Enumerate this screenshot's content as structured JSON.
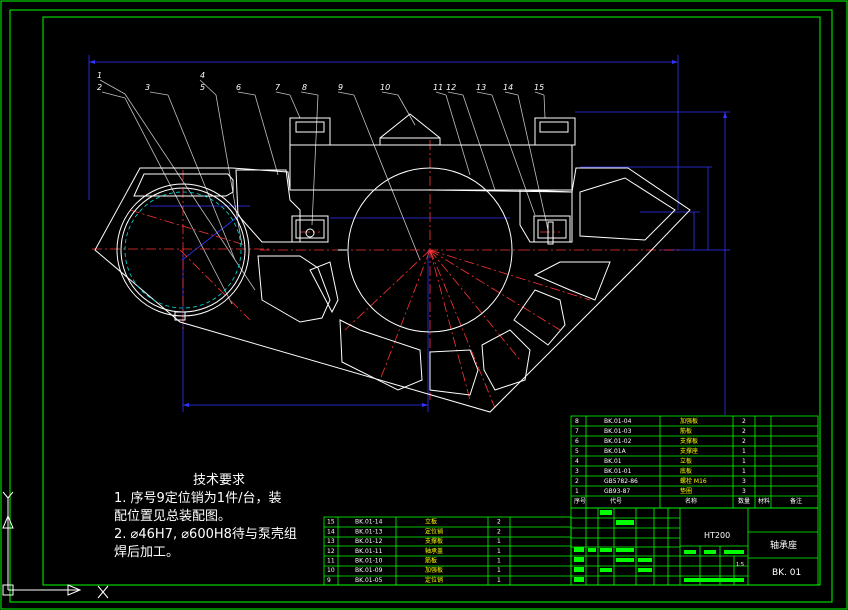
{
  "colors": {
    "background": "#000000",
    "frame": "#00ff00",
    "outline": "#ffffff",
    "dimension": "#3333ff",
    "centerline": "#ff3333",
    "leader": "#c0c0c0",
    "text_yellow": "#ffff00"
  },
  "title_block": {
    "material": "HT200",
    "part_name": "轴承座",
    "drawing_no": "BK. 01",
    "scale": "1:5"
  },
  "tech_notes": {
    "title": "技术要求",
    "lines": [
      "1. 序号9定位销为1件/台，装",
      "配位置见总装配图。",
      "2. ⌀46H7, ⌀600H8待与泵壳组",
      "焊后加工。"
    ]
  },
  "balloons": [
    "1",
    "2",
    "3",
    "4",
    "5",
    "6",
    "7",
    "8",
    "9",
    "10",
    "11",
    "12",
    "13",
    "14",
    "15"
  ],
  "parts_list_right": {
    "header": [
      "序号",
      "代号",
      "名称",
      "数量",
      "材料",
      "备注"
    ],
    "rows": [
      [
        "8",
        "BK.01-04",
        "加强板",
        "2"
      ],
      [
        "7",
        "BK.01-03",
        "筋板",
        "2"
      ],
      [
        "6",
        "BK.01-02",
        "支撑板",
        "2"
      ],
      [
        "5",
        "BK.01A",
        "支撑座",
        "1"
      ],
      [
        "4",
        "BK.01",
        "立板",
        "1"
      ],
      [
        "3",
        "BK.01-01",
        "底板",
        "1"
      ],
      [
        "2",
        "GB5782-86",
        "螺栓 M16",
        "3"
      ],
      [
        "1",
        "GB93-87",
        "垫圈",
        "3"
      ]
    ]
  },
  "parts_list_left": {
    "rows": [
      [
        "15",
        "BK.01-14",
        "立板",
        "2"
      ],
      [
        "14",
        "BK.01-13",
        "定位销",
        "2"
      ],
      [
        "13",
        "BK.01-12",
        "支撑板",
        "1"
      ],
      [
        "12",
        "BK.01-11",
        "轴承盖",
        "1"
      ],
      [
        "11",
        "BK.01-10",
        "筋板",
        "1"
      ],
      [
        "10",
        "BK.01-09",
        "加强板",
        "1"
      ],
      [
        "9",
        "BK.01-05",
        "定位销",
        "1"
      ]
    ]
  },
  "icons": {
    "ucs": "ucs-axis-icon"
  }
}
